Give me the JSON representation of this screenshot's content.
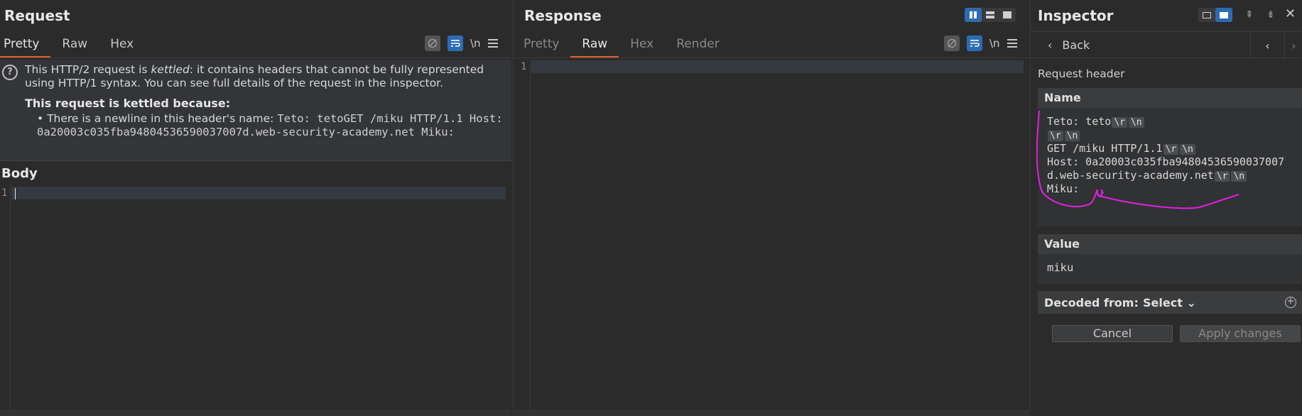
{
  "request": {
    "title": "Request",
    "tabs": [
      "Pretty",
      "Raw",
      "Hex"
    ],
    "active_tab": "Pretty",
    "toolbar": {
      "newline_label": "\\n"
    },
    "notice": {
      "text_before": "This HTTP/2 request is ",
      "text_em": "kettled",
      "text_after": ": it contains headers that cannot be fully represented using HTTP/1 syntax. You can see full details of the request in the inspector.",
      "heading": "This request is kettled because:",
      "bullet_prefix": "• There is a newline in this header's name: ",
      "bullet_code": "Teto: tetoGET /miku HTTP/1.1 Host: 0a20003c035fba94804536590037007d.web-security-academy.net Miku:"
    },
    "body_title": "Body",
    "body_line": "1"
  },
  "response": {
    "title": "Response",
    "tabs": [
      "Pretty",
      "Raw",
      "Hex",
      "Render"
    ],
    "active_tab": "Raw",
    "toolbar": {
      "newline_label": "\\n"
    },
    "line": "1"
  },
  "inspector": {
    "title": "Inspector",
    "back_label": "Back",
    "prev_icon": "‹",
    "next_icon": "›",
    "section_label": "Request header",
    "name_head": "Name",
    "name_parts": {
      "l1": "Teto: teto",
      "l3": "GET /miku HTTP/1.1",
      "l4": "Host: 0a20003c035fba94804536590037007d.web-security-academy.net",
      "l5": "Miku:"
    },
    "escape_cr": "\\r",
    "escape_lf": "\\n",
    "value_head": "Value",
    "value": "miku",
    "decoded_label": "Decoded from:",
    "select_label": "Select ⌄",
    "cancel_label": "Cancel",
    "apply_label": "Apply changes",
    "annotation_color": "#e020e0"
  },
  "colors": {
    "accent_tab": "#e0622b",
    "button_blue": "#2d6bb3",
    "background": "#2b2b2b"
  }
}
